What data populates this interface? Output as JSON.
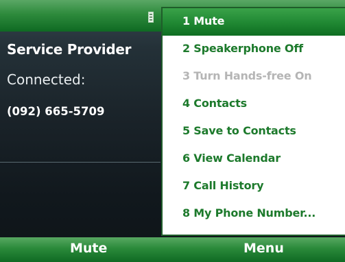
{
  "call": {
    "carrier": "Service Provider",
    "status": "Connected:",
    "number": "(092) 665-5709"
  },
  "menu": {
    "items": [
      {
        "label": "1 Mute",
        "state": "selected"
      },
      {
        "label": "2 Speakerphone Off",
        "state": "enabled"
      },
      {
        "label": "3 Turn Hands-free On",
        "state": "disabled"
      },
      {
        "label": "4 Contacts",
        "state": "enabled"
      },
      {
        "label": "5 Save to Contacts",
        "state": "enabled"
      },
      {
        "label": "6 View Calendar",
        "state": "enabled"
      },
      {
        "label": "7 Call History",
        "state": "enabled"
      },
      {
        "label": "8 My Phone Number...",
        "state": "enabled"
      }
    ]
  },
  "softkeys": {
    "left": "Mute",
    "right": "Menu"
  },
  "colors": {
    "accent_green": "#1d7a2c",
    "selection_green": "#1f8732",
    "disabled_gray": "#b5b5b5"
  },
  "icons": {
    "signal": "signal-strength-icon"
  }
}
